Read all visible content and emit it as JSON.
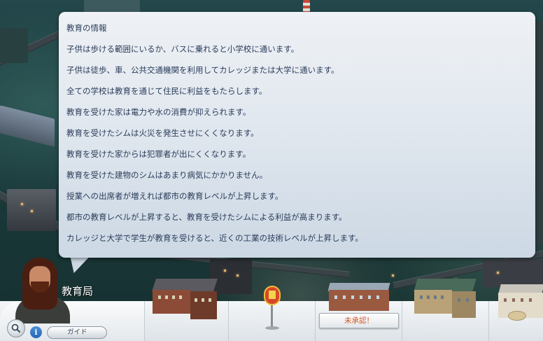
{
  "panel": {
    "title": "教育の情報",
    "lines": [
      "子供は歩ける範囲にいるか、バスに乗れると小学校に通います。",
      "子供は徒歩、車、公共交通機関を利用してカレッジまたは大学に通います。",
      "全ての学校は教育を通じて住民に利益をもたらします。",
      "教育を受けた家は電力や水の消費が抑えられます。",
      "教育を受けたシムは火災を発生させにくくなります。",
      "教育を受けた家からは犯罪者が出にくくなります。",
      "教育を受けた建物のシムはあまり病気にかかりません。",
      "授業への出席者が増えれば都市の教育レベルが上昇します。",
      "都市の教育レベルが上昇すると、教育を受けたシムによる利益が高まります。",
      "カレッジと大学で学生が教育を受けると、近くの工業の技術レベルが上昇します。"
    ]
  },
  "advisor": {
    "department": "教育局"
  },
  "controls": {
    "search_icon": "magnifier-icon",
    "info_icon_label": "i",
    "guide_label": "ガイド"
  },
  "buildings": {
    "unapproved_label": "未承認！"
  },
  "colors": {
    "panel_text": "#2a3c5a",
    "unapproved_text": "#d2541e"
  }
}
